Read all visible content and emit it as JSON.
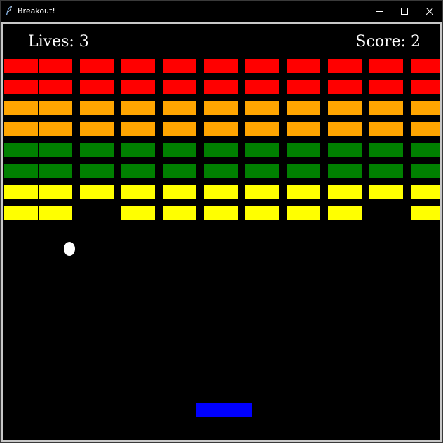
{
  "window": {
    "title": "Breakout!",
    "icon": "feather-icon",
    "controls": [
      "minimize-icon",
      "maximize-icon",
      "close-icon"
    ]
  },
  "hud": {
    "lives_text": "Lives: 3",
    "score_text": "Score: 2",
    "lives": 3,
    "score": 2
  },
  "colors": {
    "background": "#000000",
    "red": "#ff0000",
    "orange": "#ffa500",
    "green": "#008000",
    "yellow": "#ffff00",
    "ball": "#ffffff",
    "paddle": "#0000ff"
  },
  "bricks": {
    "columns": 11,
    "rows": [
      {
        "color": "red",
        "present": [
          1,
          1,
          1,
          1,
          1,
          1,
          1,
          1,
          1,
          1,
          1
        ]
      },
      {
        "color": "red",
        "present": [
          1,
          1,
          1,
          1,
          1,
          1,
          1,
          1,
          1,
          1,
          1
        ]
      },
      {
        "color": "orange",
        "present": [
          1,
          1,
          1,
          1,
          1,
          1,
          1,
          1,
          1,
          1,
          1
        ]
      },
      {
        "color": "orange",
        "present": [
          1,
          1,
          1,
          1,
          1,
          1,
          1,
          1,
          1,
          1,
          1
        ]
      },
      {
        "color": "green",
        "present": [
          1,
          1,
          1,
          1,
          1,
          1,
          1,
          1,
          1,
          1,
          1
        ]
      },
      {
        "color": "green",
        "present": [
          1,
          1,
          1,
          1,
          1,
          1,
          1,
          1,
          1,
          1,
          1
        ]
      },
      {
        "color": "yellow",
        "present": [
          1,
          1,
          1,
          1,
          1,
          1,
          1,
          1,
          1,
          1,
          1
        ]
      },
      {
        "color": "yellow",
        "present": [
          1,
          1,
          0,
          1,
          1,
          1,
          1,
          1,
          1,
          0,
          1
        ]
      }
    ]
  }
}
